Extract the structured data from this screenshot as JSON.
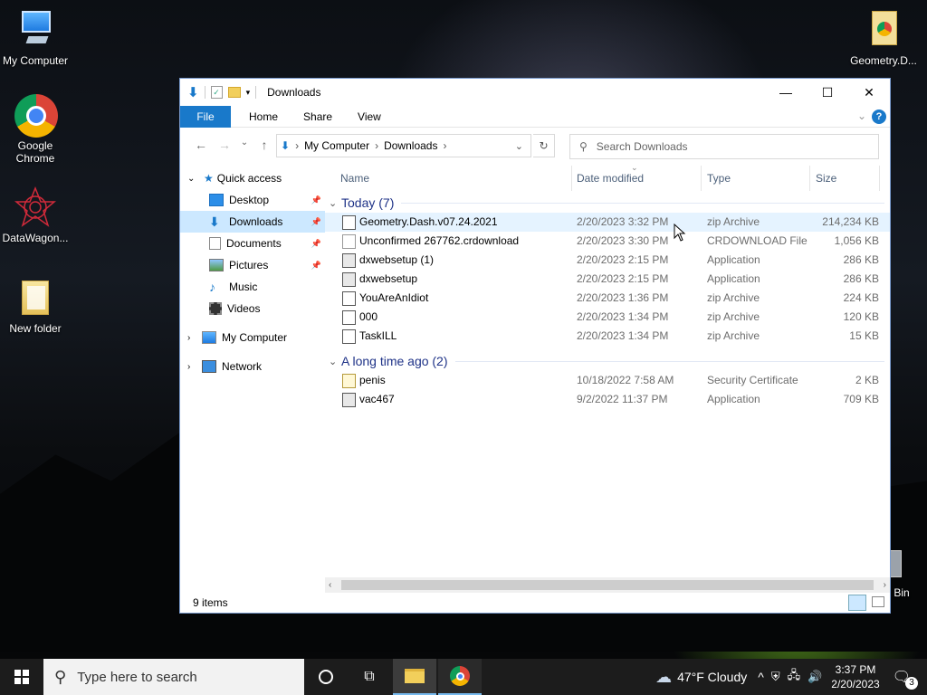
{
  "desktop": {
    "icons": [
      {
        "label": "My Computer",
        "icon": "computer-icon"
      },
      {
        "label": "Google Chrome",
        "icon": "chrome-icon"
      },
      {
        "label": "DataWagon...",
        "icon": "datawagon-icon"
      },
      {
        "label": "New folder",
        "icon": "folder-icon"
      },
      {
        "label": "Geometry.D...",
        "icon": "chrome-file-icon"
      },
      {
        "label": "Bin",
        "icon": "recycle-bin-icon"
      }
    ]
  },
  "window": {
    "title": "Downloads",
    "ribbon_tabs": [
      "File",
      "Home",
      "Share",
      "View"
    ],
    "breadcrumb": [
      "My Computer",
      "Downloads"
    ],
    "search_placeholder": "Search Downloads",
    "nav": {
      "quick_access": "Quick access",
      "items": [
        "Desktop",
        "Downloads",
        "Documents",
        "Pictures",
        "Music",
        "Videos"
      ],
      "my_computer": "My Computer",
      "network": "Network"
    },
    "columns": [
      "Name",
      "Date modified",
      "Type",
      "Size"
    ],
    "groups": [
      {
        "label": "Today (7)",
        "files": [
          {
            "name": "Geometry.Dash.v07.24.2021",
            "date": "2/20/2023 3:32 PM",
            "type": "zip Archive",
            "size": "214,234 KB",
            "icon": "zip"
          },
          {
            "name": "Unconfirmed 267762.crdownload",
            "date": "2/20/2023 3:30 PM",
            "type": "CRDOWNLOAD File",
            "size": "1,056 KB",
            "icon": "file"
          },
          {
            "name": "dxwebsetup (1)",
            "date": "2/20/2023 2:15 PM",
            "type": "Application",
            "size": "286 KB",
            "icon": "app"
          },
          {
            "name": "dxwebsetup",
            "date": "2/20/2023 2:15 PM",
            "type": "Application",
            "size": "286 KB",
            "icon": "app"
          },
          {
            "name": "YouAreAnIdiot",
            "date": "2/20/2023 1:36 PM",
            "type": "zip Archive",
            "size": "224 KB",
            "icon": "zip"
          },
          {
            "name": "000",
            "date": "2/20/2023 1:34 PM",
            "type": "zip Archive",
            "size": "120 KB",
            "icon": "zip"
          },
          {
            "name": "TaskILL",
            "date": "2/20/2023 1:34 PM",
            "type": "zip Archive",
            "size": "15 KB",
            "icon": "zip"
          }
        ]
      },
      {
        "label": "A long time ago (2)",
        "files": [
          {
            "name": "penis",
            "date": "10/18/2022 7:58 AM",
            "type": "Security Certificate",
            "size": "2 KB",
            "icon": "cert"
          },
          {
            "name": "vac467",
            "date": "9/2/2022 11:37 PM",
            "type": "Application",
            "size": "709 KB",
            "icon": "app"
          }
        ]
      }
    ],
    "status": "9 items"
  },
  "taskbar": {
    "search_placeholder": "Type here to search",
    "weather": "47°F  Cloudy",
    "time": "3:37 PM",
    "date": "2/20/2023",
    "notifications": "3"
  },
  "colors": {
    "accent": "#1979ca",
    "selected": "#cce8ff",
    "hover": "#e5f3ff",
    "group": "#1e3287"
  }
}
